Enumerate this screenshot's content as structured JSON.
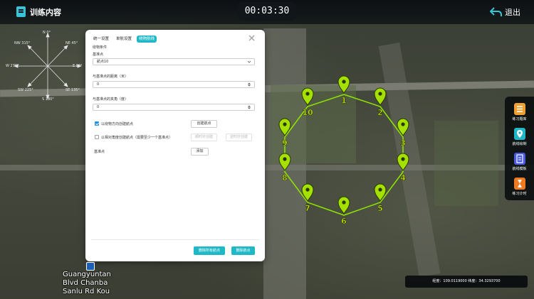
{
  "app": {
    "title": "训练内容",
    "timer": "00:03:30",
    "exit_label": "退出"
  },
  "compass": {
    "labels": {
      "n": "N 0°",
      "ne": "NE 45°",
      "e": "E 90°",
      "se": "SE 135°",
      "s": "S 180°",
      "sw": "SW 225°",
      "w": "W 270°",
      "nw": "NW 315°"
    }
  },
  "dialog": {
    "tabs": [
      "统一设置",
      "单航设置",
      "绕物航线"
    ],
    "active_tab": 2,
    "section_title": "绕物条件",
    "base_point_label": "基准点",
    "base_point_value": "航点10",
    "distance_label": "与基准点的距离（米）",
    "distance_value": "0",
    "angle_label": "与基准点的夹角（度）",
    "angle_value": "0",
    "option1_label": "以绕物方向创建航点",
    "option1_checked": true,
    "option1_button": "创建航点",
    "option2_label": "以相对角度创建航点（需要至少一个基准点）",
    "option2_checked": false,
    "option2_button_a": "顺时针创建",
    "option2_button_b": "逆时针创建",
    "base_point2_label": "基准点",
    "add_button": "添加",
    "footer_btn_clear": "删除所有航点",
    "footer_btn_delete": "删除航点"
  },
  "sidepanel": {
    "items": [
      {
        "label": "练习题库",
        "icon": "list-icon",
        "color": "#f0a030"
      },
      {
        "label": "航线绘制",
        "icon": "map-pin-icon",
        "color": "#1fb8c6"
      },
      {
        "label": "航线模板",
        "icon": "template-icon",
        "color": "#4a5be0"
      },
      {
        "label": "练习计时",
        "icon": "hourglass-icon",
        "color": "#f07a20"
      }
    ]
  },
  "coords": {
    "text": "经度：109.0119000 纬度：34.3293700"
  },
  "map_label": {
    "line1": "Guangyuntan",
    "line2": "Blvd Chanba",
    "line3": "Sanlu Rd Kou"
  },
  "waypoints": [
    "1",
    "2",
    "3",
    "4",
    "5",
    "6",
    "7",
    "8",
    "9",
    "10"
  ],
  "colors": {
    "accent": "#1fb8c6",
    "waypoint": "#a4e000",
    "route": "#8ee000"
  }
}
